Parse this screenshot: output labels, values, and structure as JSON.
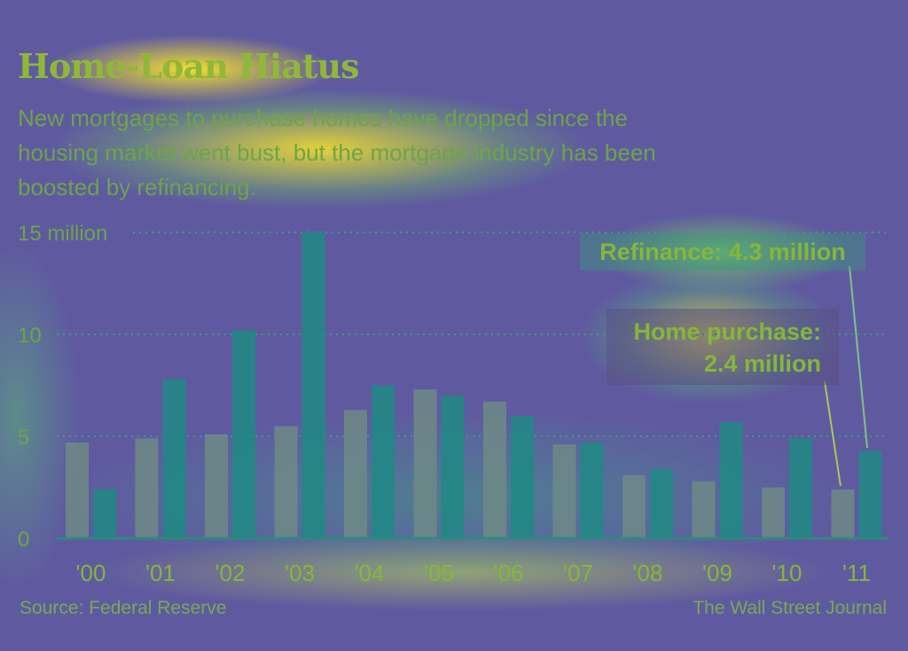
{
  "title": "Home-Loan Hiatus",
  "subtitle": "New mortgages to purchase homes have dropped since the housing market went bust, but the mortgage industry has been boosted by refinancing.",
  "annotations": {
    "refinance": "Refinance: 4.3 million",
    "home_purchase_line1": "Home purchase:",
    "home_purchase_line2": "2.4 million"
  },
  "source": "Source: Federal Reserve",
  "credit": "The Wall Street Journal",
  "colors": {
    "home_purchase": "#6f8a86",
    "refinance": "#1f8a84",
    "axis": "#2e8a7e",
    "text": "#86b63a"
  },
  "chart_data": {
    "type": "bar",
    "categories": [
      "'00",
      "'01",
      "'02",
      "'03",
      "'04",
      "'05",
      "'06",
      "'07",
      "'08",
      "'09",
      "'10",
      "'11"
    ],
    "series": [
      {
        "name": "Home purchase",
        "values": [
          4.7,
          4.9,
          5.1,
          5.5,
          6.3,
          7.3,
          6.7,
          4.6,
          3.1,
          2.8,
          2.5,
          2.4
        ]
      },
      {
        "name": "Refinance",
        "values": [
          2.4,
          7.8,
          10.2,
          15.0,
          7.5,
          7.0,
          6.0,
          4.7,
          3.4,
          5.7,
          4.9,
          4.3
        ]
      }
    ],
    "yticks": [
      "0",
      "5",
      "10",
      "15 million"
    ],
    "ytick_values": [
      0,
      5,
      10,
      15
    ],
    "ylim": [
      0,
      15
    ],
    "grid": true
  }
}
